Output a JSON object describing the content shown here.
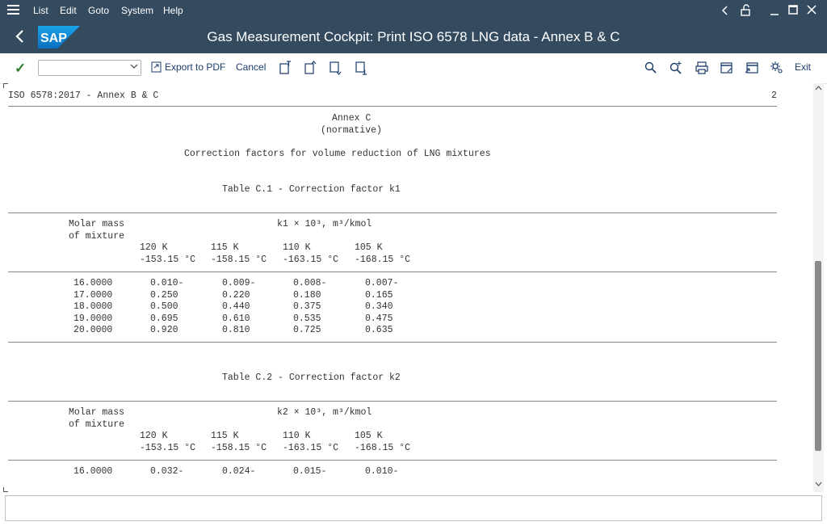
{
  "menubar": {
    "items": [
      "List",
      "Edit",
      "Goto",
      "System",
      "Help"
    ]
  },
  "titlebar": {
    "logo_text": "SAP",
    "title": "Gas Measurement Cockpit: Print ISO 6578 LNG data - Annex B & C"
  },
  "toolbar": {
    "select_value": "",
    "export_label": "Export to PDF",
    "cancel_label": "Cancel",
    "exit_label": "Exit"
  },
  "report": {
    "header_left": "ISO 6578:2017 - Annex B & C",
    "page_number": "2",
    "annex_title": "Annex C",
    "annex_subtitle": "(normative)",
    "heading": "Correction factors for volume reduction of LNG mixtures",
    "tables": [
      {
        "caption": "Table C.1 - Correction factor k1",
        "row_label_1": "Molar mass",
        "row_label_2": "of mixture",
        "quantity": "k1 × 10³, m³/kmol",
        "kelvin": [
          "120 K",
          "115 K",
          "110 K",
          "105 K"
        ],
        "celsius": [
          "-153.15 °C",
          "-158.15 °C",
          "-163.15 °C",
          "-168.15 °C"
        ],
        "rows": [
          {
            "mass": "16.0000",
            "values": [
              "0.010-",
              "0.009-",
              "0.008-",
              "0.007-"
            ]
          },
          {
            "mass": "17.0000",
            "values": [
              "0.250",
              "0.220",
              "0.180",
              "0.165"
            ]
          },
          {
            "mass": "18.0000",
            "values": [
              "0.500",
              "0.440",
              "0.375",
              "0.340"
            ]
          },
          {
            "mass": "19.0000",
            "values": [
              "0.695",
              "0.610",
              "0.535",
              "0.475"
            ]
          },
          {
            "mass": "20.0000",
            "values": [
              "0.920",
              "0.810",
              "0.725",
              "0.635"
            ]
          }
        ]
      },
      {
        "caption": "Table C.2 - Correction factor k2",
        "row_label_1": "Molar mass",
        "row_label_2": "of mixture",
        "quantity": "k2 × 10³, m³/kmol",
        "kelvin": [
          "120 K",
          "115 K",
          "110 K",
          "105 K"
        ],
        "celsius": [
          "-153.15 °C",
          "-158.15 °C",
          "-163.15 °C",
          "-168.15 °C"
        ],
        "rows": [
          {
            "mass": "16.0000",
            "values": [
              "0.032-",
              "0.024-",
              "0.015-",
              "0.010-"
            ]
          }
        ]
      }
    ]
  },
  "statusbar": {
    "text": ""
  }
}
